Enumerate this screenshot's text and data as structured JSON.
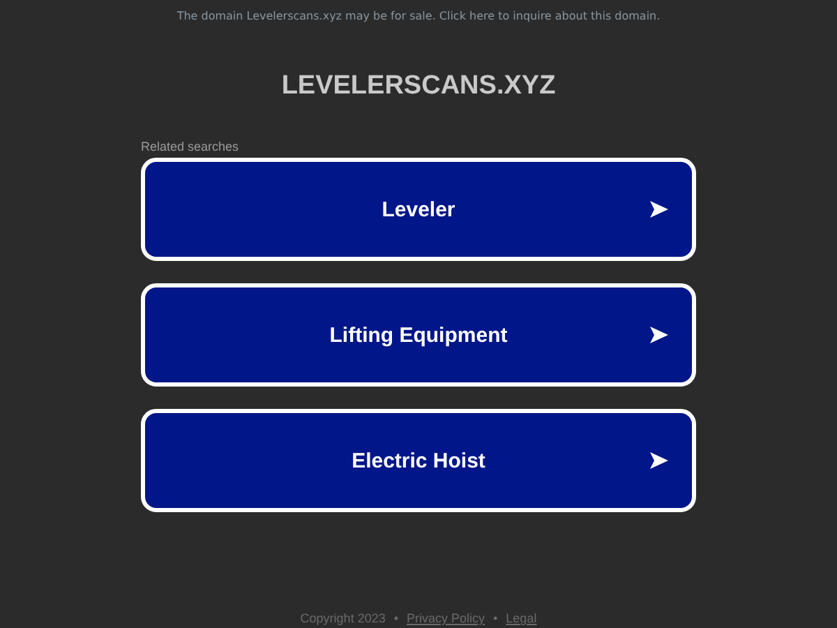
{
  "banner": "The domain Levelerscans.xyz may be for sale. Click here to inquire about this domain.",
  "title": "LEVELERSCANS.XYZ",
  "related_label": "Related searches",
  "searches": [
    {
      "label": "Leveler"
    },
    {
      "label": "Lifting Equipment"
    },
    {
      "label": "Electric Hoist"
    }
  ],
  "footer": {
    "copyright": "Copyright 2023",
    "separator_1": "•",
    "privacy": "Privacy Policy",
    "separator_2": "•",
    "legal": "Legal"
  }
}
